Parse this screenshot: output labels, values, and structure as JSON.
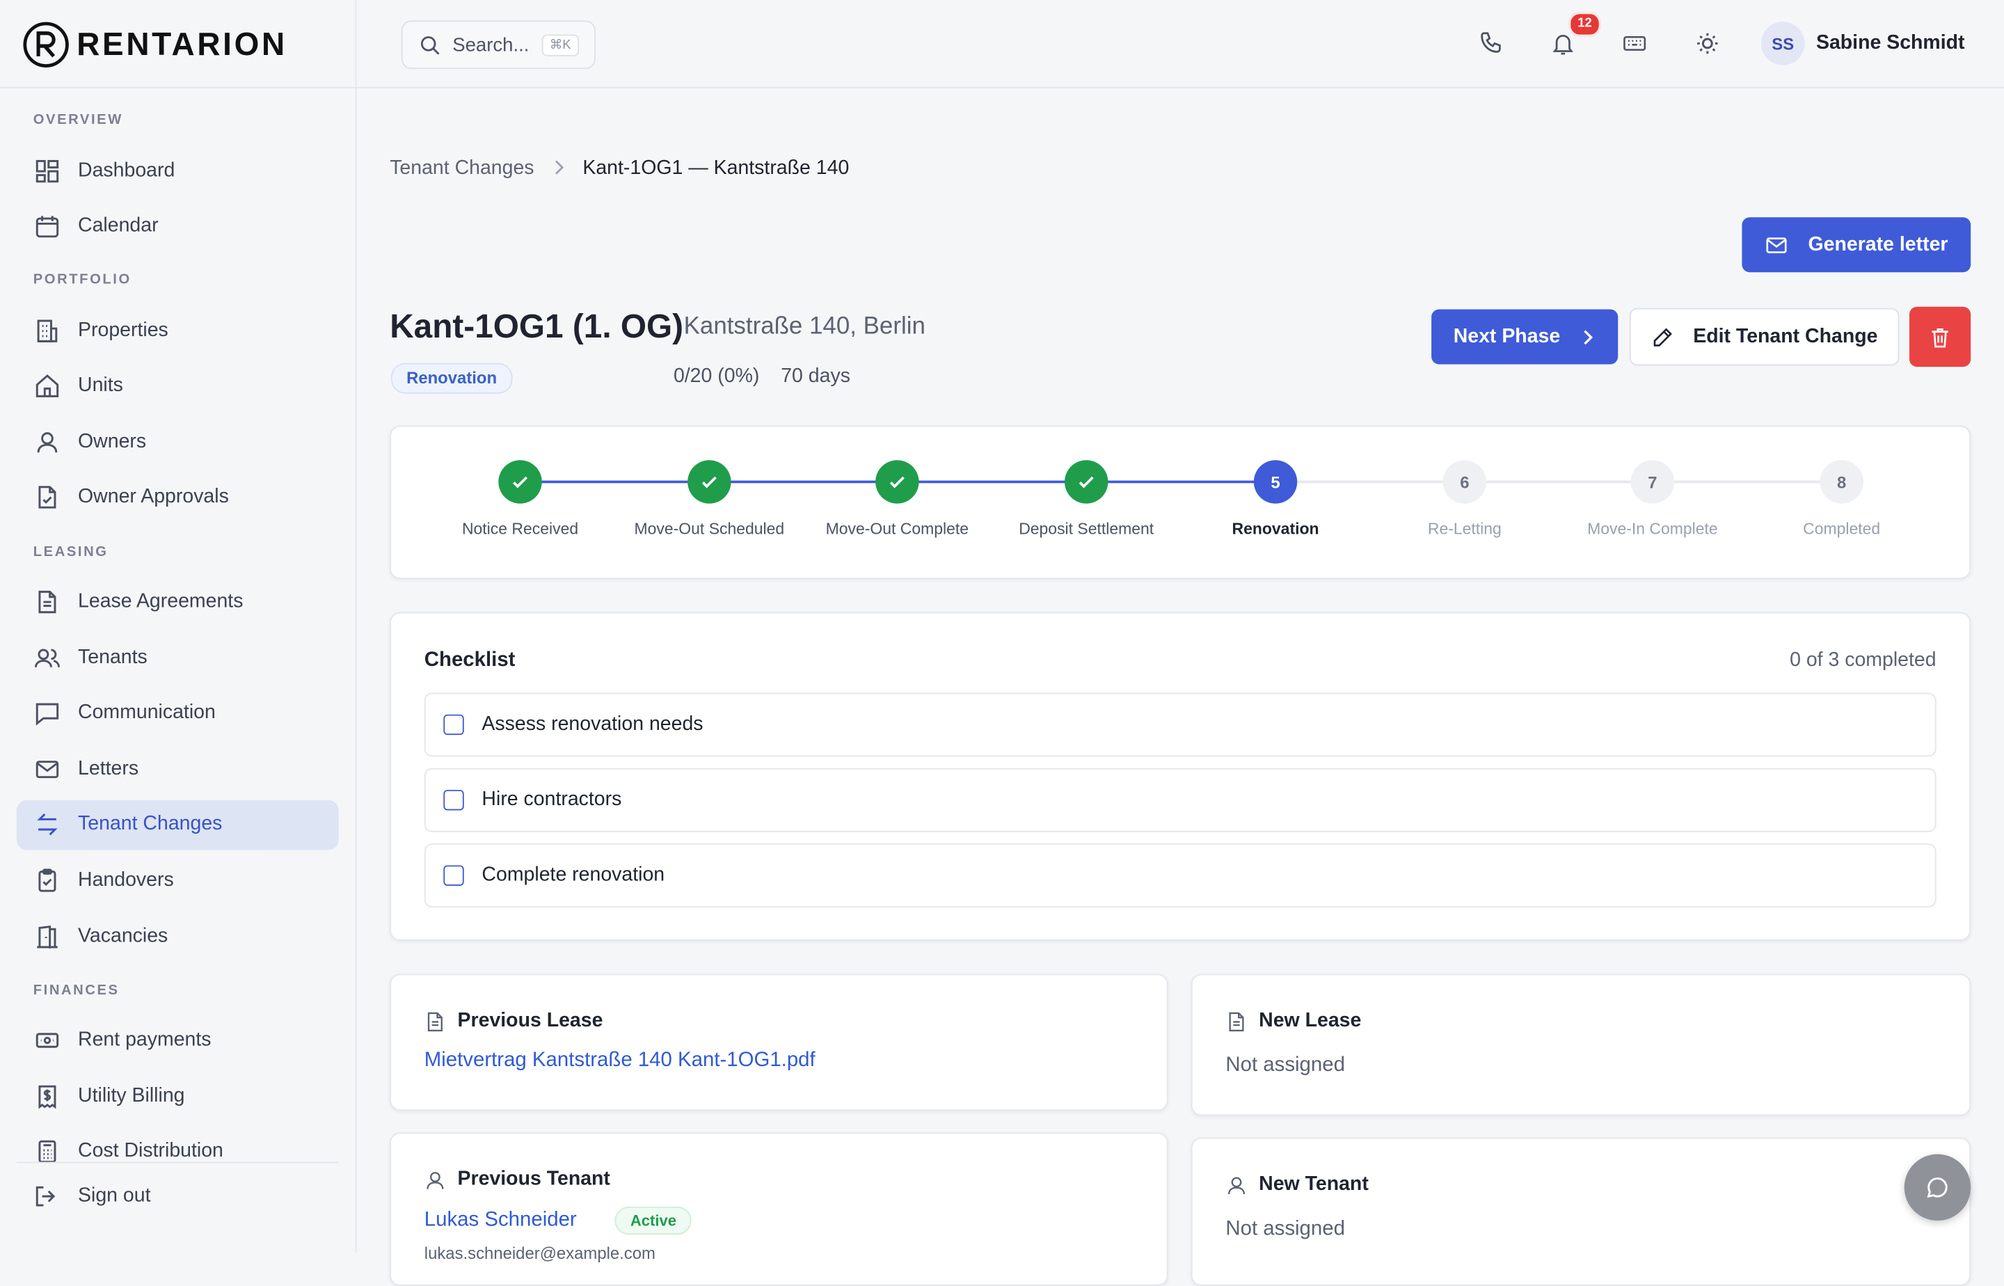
{
  "brand": {
    "name": "RENTARION"
  },
  "sidebar": {
    "sections": [
      {
        "label": "OVERVIEW",
        "items": [
          {
            "label": "Dashboard",
            "icon": "dashboard-icon"
          },
          {
            "label": "Calendar",
            "icon": "calendar-icon"
          }
        ]
      },
      {
        "label": "PORTFOLIO",
        "items": [
          {
            "label": "Properties",
            "icon": "building-icon"
          },
          {
            "label": "Units",
            "icon": "home-icon"
          },
          {
            "label": "Owners",
            "icon": "user-icon"
          },
          {
            "label": "Owner Approvals",
            "icon": "file-check-icon"
          }
        ]
      },
      {
        "label": "LEASING",
        "items": [
          {
            "label": "Lease Agreements",
            "icon": "document-icon"
          },
          {
            "label": "Tenants",
            "icon": "users-icon"
          },
          {
            "label": "Communication",
            "icon": "chat-icon"
          },
          {
            "label": "Letters",
            "icon": "mail-icon"
          },
          {
            "label": "Tenant Changes",
            "icon": "swap-icon",
            "active": true
          },
          {
            "label": "Handovers",
            "icon": "clipboard-check-icon"
          },
          {
            "label": "Vacancies",
            "icon": "door-icon"
          }
        ]
      },
      {
        "label": "FINANCES",
        "items": [
          {
            "label": "Rent payments",
            "icon": "banknote-icon"
          },
          {
            "label": "Utility Billing",
            "icon": "receipt-icon"
          },
          {
            "label": "Cost Distribution",
            "icon": "calculator-icon"
          }
        ]
      }
    ],
    "signout": "Sign out"
  },
  "topbar": {
    "search_placeholder": "Search...",
    "search_shortcut": "⌘K",
    "notification_count": "12",
    "user_initials": "SS",
    "user_name": "Sabine Schmidt"
  },
  "breadcrumb": {
    "parent": "Tenant Changes",
    "current": "Kant-1OG1 — Kantstraße 140"
  },
  "actions": {
    "generate_letter": "Generate letter",
    "next_phase": "Next Phase",
    "edit": "Edit Tenant Change"
  },
  "header": {
    "title": "Kant-1OG1 (1. OG)",
    "address": "Kantstraße 140, Berlin",
    "phase_badge": "Renovation",
    "progress": "0/20 (0%)",
    "days": "70 days"
  },
  "stepper": {
    "steps": [
      {
        "label": "Notice Received",
        "status": "done",
        "number": "1"
      },
      {
        "label": "Move-Out Scheduled",
        "status": "done",
        "number": "2"
      },
      {
        "label": "Move-Out Complete",
        "status": "done",
        "number": "3"
      },
      {
        "label": "Deposit Settlement",
        "status": "done",
        "number": "4"
      },
      {
        "label": "Renovation",
        "status": "current",
        "number": "5"
      },
      {
        "label": "Re-Letting",
        "status": "todo",
        "number": "6"
      },
      {
        "label": "Move-In Complete",
        "status": "todo",
        "number": "7"
      },
      {
        "label": "Completed",
        "status": "todo",
        "number": "8"
      }
    ]
  },
  "checklist": {
    "title": "Checklist",
    "count": "0 of 3 completed",
    "items": [
      {
        "label": "Assess renovation needs",
        "checked": false
      },
      {
        "label": "Hire contractors",
        "checked": false
      },
      {
        "label": "Complete renovation",
        "checked": false
      }
    ]
  },
  "leases": {
    "previous": {
      "title": "Previous Lease",
      "file": "Mietvertrag Kantstraße 140 Kant-1OG1.pdf"
    },
    "new": {
      "title": "New Lease",
      "value": "Not assigned"
    }
  },
  "tenants": {
    "previous": {
      "title": "Previous Tenant",
      "name": "Lukas Schneider",
      "status": "Active",
      "email": "lukas.schneider@example.com"
    },
    "new": {
      "title": "New Tenant",
      "value": "Not assigned"
    }
  },
  "colors": {
    "primary": "#3f5bd8",
    "success": "#1f9d4b",
    "danger": "#ea4343"
  }
}
